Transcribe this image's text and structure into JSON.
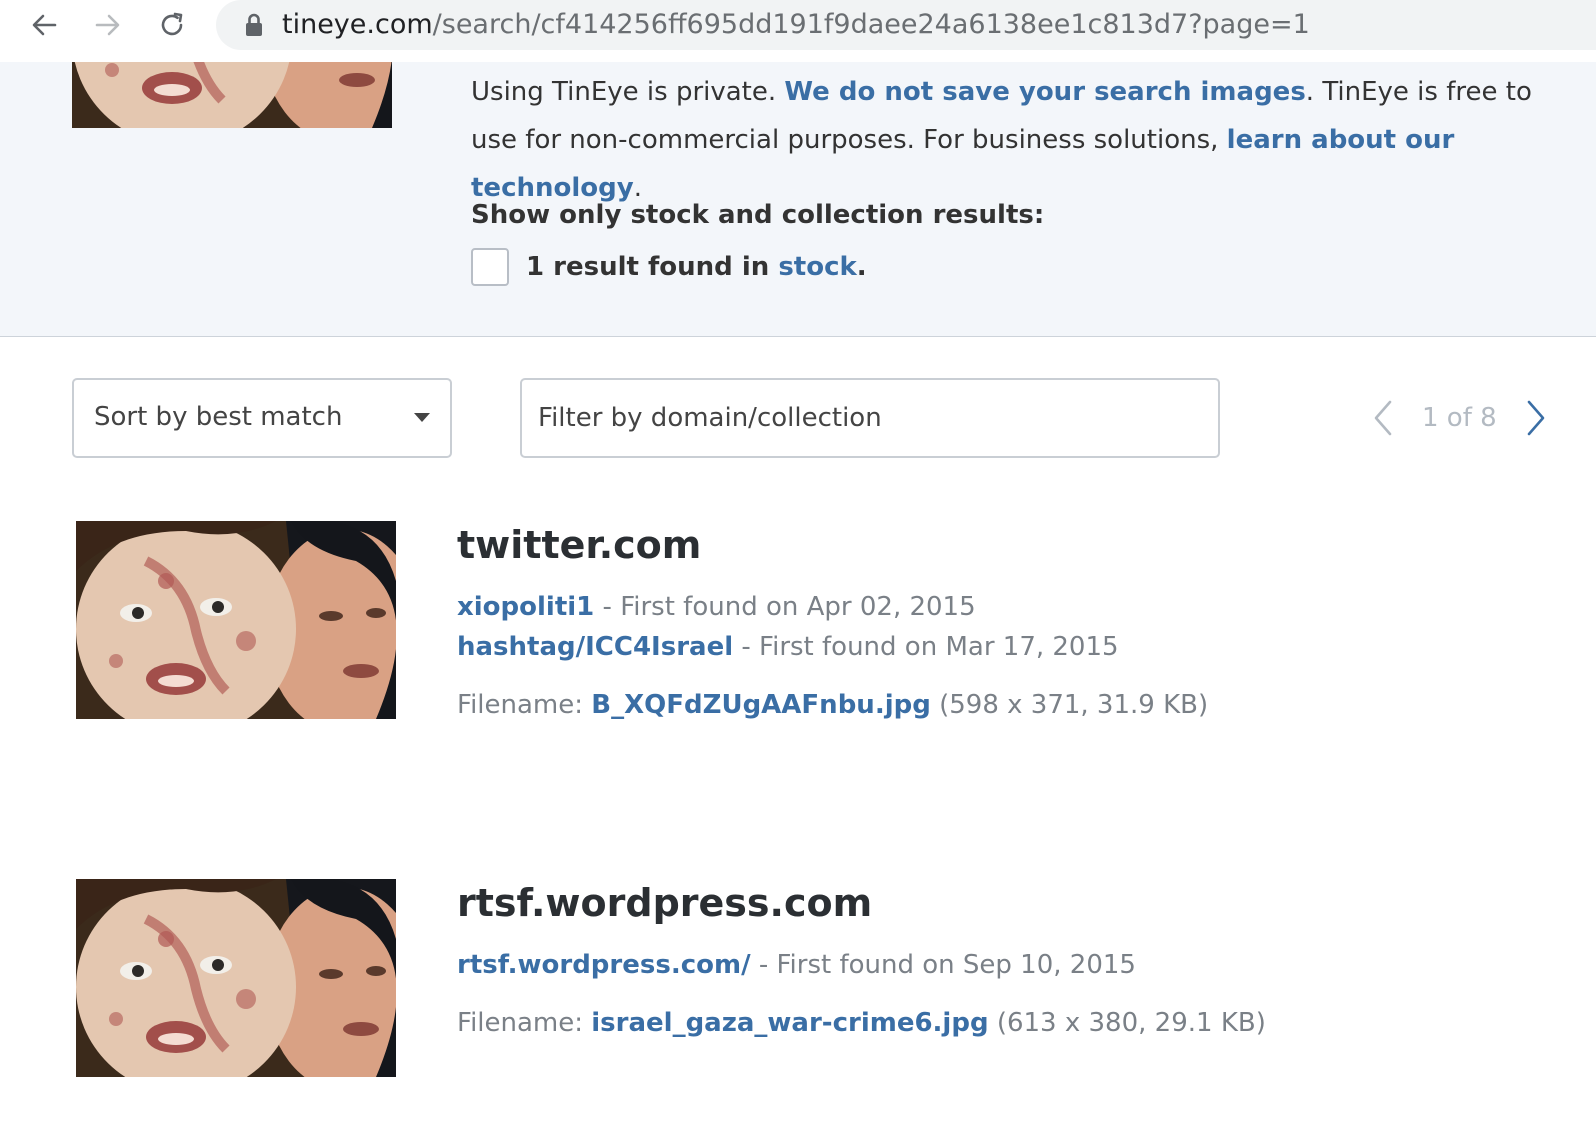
{
  "browser": {
    "url_domain": "tineye.com",
    "url_path": "/search/cf414256ff695dd191f9daee24a6138ee1c813d7?page=1",
    "back_icon": "arrow-left-icon",
    "forward_icon": "arrow-right-icon",
    "reload_icon": "reload-icon",
    "lock_icon": "lock-icon"
  },
  "info": {
    "privacy_text_1": "Using TinEye is private. ",
    "privacy_link_1": "We do not save your search images",
    "privacy_text_2": ". TinEye is free to use for non-commercial purposes. For business solutions, ",
    "privacy_link_2": "learn about our technology",
    "privacy_text_3": ".",
    "stock_heading": "Show only stock and collection results:",
    "stock_text": "1 result found in ",
    "stock_link": "stock",
    "stock_suffix": "."
  },
  "controls": {
    "sort_label": "Sort by best match",
    "filter_placeholder": "Filter by domain/collection",
    "pager_text": "1  of  8"
  },
  "results": [
    {
      "domain": "twitter.com",
      "matches": [
        {
          "link": "xiopoliti1",
          "text": " - First found on Apr 02, 2015"
        },
        {
          "link": "hashtag/ICC4Israel",
          "text": " - First found on Mar 17, 2015"
        }
      ],
      "filename_label": "Filename: ",
      "filename": "B_XQFdZUgAAFnbu.jpg",
      "file_info": " (598 x 371, 31.9 KB)"
    },
    {
      "domain": "rtsf.wordpress.com",
      "matches": [
        {
          "link": "rtsf.wordpress.com/",
          "text": " - First found on Sep 10, 2015"
        }
      ],
      "filename_label": "Filename: ",
      "filename": "israel_gaza_war-crime6.jpg",
      "file_info": " (613 x 380, 29.1 KB)"
    }
  ],
  "colors": {
    "link": "#3a6ea5",
    "band_background": "#f3f6fa",
    "muted_text": "#7a8087"
  }
}
